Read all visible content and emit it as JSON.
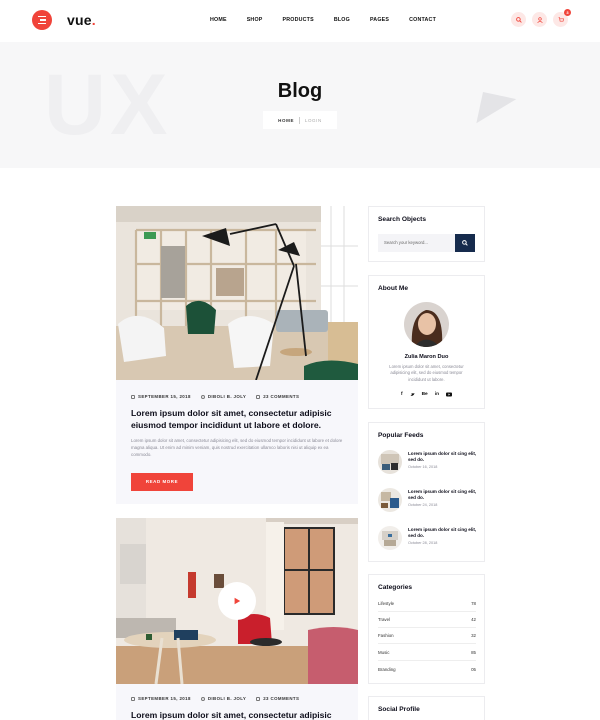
{
  "header": {
    "logo": "vue",
    "logo_dot": ".",
    "nav": [
      "HOME",
      "SHOP",
      "PRODUCTS",
      "BLOG",
      "PAGES",
      "CONTACT"
    ],
    "cart_count": "3"
  },
  "hero": {
    "watermark": "UX",
    "title": "Blog",
    "crumb_home": "HOME",
    "crumb_current": "LOGIN"
  },
  "posts": [
    {
      "date": "SEPTEMBER 15, 2018",
      "author": "DIBOLI B. JOLY",
      "comments": "23 COMMENTS",
      "title": "Lorem ipsum dolor sit amet, consectetur adipisic eiusmod tempor incididunt ut labore et dolore.",
      "excerpt": "Lorem ipsum dolor sit amet, consectetur adipisicing elit, sed do eiusmod tempor incididunt ut labore et dolore magna aliqua. Ut enim ad minim veniam, quis nostrud exercitation ullamco laboris nisi ut aliquip ex ea commodo.",
      "button": "READ MORE"
    },
    {
      "date": "SEPTEMBER 15, 2018",
      "author": "DIBOLI B. JOLY",
      "comments": "23 COMMENTS",
      "title": "Lorem ipsum dolor sit amet, consectetur adipisic"
    }
  ],
  "sidebar": {
    "search": {
      "title": "Search Objects",
      "placeholder": "Search your keyword..."
    },
    "about": {
      "title": "About Me",
      "name": "Zulia Maron Duo",
      "text": "Lorem ipsum dolor sit amet, consectetur adipisicing elit, sed do eiusmod tempor incididunt ut labore.",
      "socials": [
        "f",
        "t",
        "Be",
        "in",
        "yt"
      ]
    },
    "feeds": {
      "title": "Popular Feeds",
      "items": [
        {
          "title": "Lorem ipsum dolor sit cing elit, sed do.",
          "date": "October 16, 2018"
        },
        {
          "title": "Lorem ipsum dolor sit cing elit, sed do.",
          "date": "October 24, 2018"
        },
        {
          "title": "Lorem ipsum dolor sit cing elit, sed do.",
          "date": "October 28, 2018"
        }
      ]
    },
    "categories": {
      "title": "Categories",
      "items": [
        {
          "name": "Lifestyle",
          "count": "78"
        },
        {
          "name": "Travel",
          "count": "42"
        },
        {
          "name": "Fashion",
          "count": "32"
        },
        {
          "name": "Music",
          "count": "85"
        },
        {
          "name": "Branding",
          "count": "05"
        }
      ]
    },
    "social": {
      "title": "Social Profile"
    }
  },
  "colors": {
    "accent": "#f0443a",
    "navy": "#162b4d",
    "hero_bg": "#f7f7f8"
  }
}
